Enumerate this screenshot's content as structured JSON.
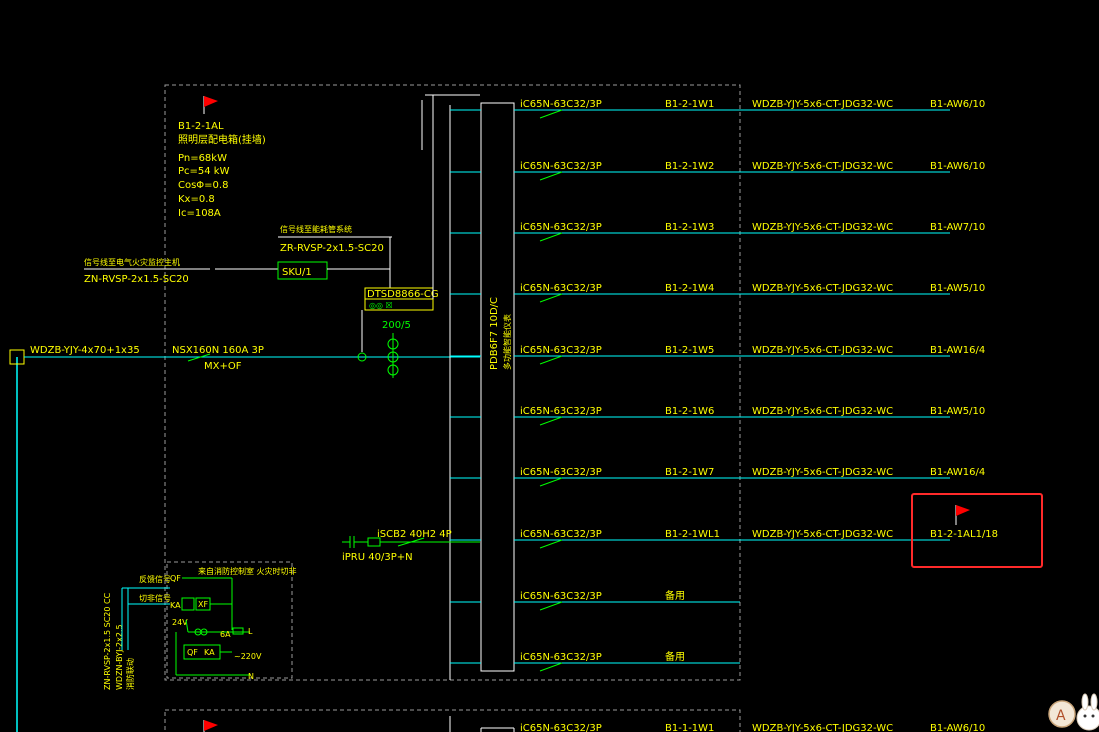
{
  "panel": {
    "id": "B1-2-1AL",
    "name": "照明层配电箱(挂墙)",
    "params": [
      "Pn=68kW",
      "Pc=54 kW",
      "CosΦ=0.8",
      "Kx=0.8",
      "Ic=108A"
    ]
  },
  "incoming": {
    "cable": "WDZB-YJY-4x70+1x35",
    "breaker": "NSX160N 160A 3P",
    "breaker_sub": "MX+OF"
  },
  "fire_monitor": {
    "title": "信号线至电气火灾监控主机",
    "cable": "ZN-RVSP-2x1.5-SC20"
  },
  "energy_monitor": {
    "title": "信号线至能耗管系统",
    "cable": "ZR-RVSP-2x1.5-SC20",
    "module": "SKU/1",
    "meter": "DTSD8866-CG",
    "meter_sub": "◎◎ ☒",
    "ct": "200/5"
  },
  "busbar": {
    "label": "PDB6F7 10D/C",
    "sub": "多功能智能仪表"
  },
  "spd": {
    "breaker": "iSCB2 40H2 4P",
    "surge": "iPRU 40/3P+N"
  },
  "circuits": [
    {
      "breaker": "iC65N-63C32/3P",
      "id": "B1-2-1W1",
      "cable": "WDZB-YJY-5x6-CT-JDG32-WC",
      "dest": "B1-AW6/10"
    },
    {
      "breaker": "iC65N-63C32/3P",
      "id": "B1-2-1W2",
      "cable": "WDZB-YJY-5x6-CT-JDG32-WC",
      "dest": "B1-AW6/10"
    },
    {
      "breaker": "iC65N-63C32/3P",
      "id": "B1-2-1W3",
      "cable": "WDZB-YJY-5x6-CT-JDG32-WC",
      "dest": "B1-AW7/10"
    },
    {
      "breaker": "iC65N-63C32/3P",
      "id": "B1-2-1W4",
      "cable": "WDZB-YJY-5x6-CT-JDG32-WC",
      "dest": "B1-AW5/10"
    },
    {
      "breaker": "iC65N-63C32/3P",
      "id": "B1-2-1W5",
      "cable": "WDZB-YJY-5x6-CT-JDG32-WC",
      "dest": "B1-AW16/4"
    },
    {
      "breaker": "iC65N-63C32/3P",
      "id": "B1-2-1W6",
      "cable": "WDZB-YJY-5x6-CT-JDG32-WC",
      "dest": "B1-AW5/10"
    },
    {
      "breaker": "iC65N-63C32/3P",
      "id": "B1-2-1W7",
      "cable": "WDZB-YJY-5x6-CT-JDG32-WC",
      "dest": "B1-AW16/4"
    },
    {
      "breaker": "iC65N-63C32/3P",
      "id": "B1-2-1WL1",
      "cable": "WDZB-YJY-5x6-CT-JDG32-WC",
      "dest": "B1-2-1AL1/18"
    },
    {
      "breaker": "iC65N-63C32/3P",
      "id": "备用",
      "cable": "",
      "dest": ""
    },
    {
      "breaker": "iC65N-63C32/3P",
      "id": "备用",
      "cable": "",
      "dest": ""
    }
  ],
  "control": {
    "cable_a": "ZN-RVSP-2x1.5 SC20 CC",
    "cable_b": "WDZN-BYJ-2x2.5",
    "title": "消防联动",
    "labels": [
      "反馈信号",
      "切非信号",
      "KA",
      "24V",
      "XF",
      "QF",
      "KA",
      "6A",
      "~220V",
      "N",
      "L"
    ],
    "note": "来自消防控制室 火灾时切非"
  },
  "next_panel": {
    "breaker": "iC65N-63C32/3P",
    "id": "B1-1-1W1",
    "cable": "WDZB-YJY-5x6-CT-JDG32-WC",
    "dest": "B1-AW6/10"
  },
  "avatar": {
    "letter": "A"
  },
  "colors": {
    "line": "#00ffff",
    "text": "#ffff00",
    "green": "#00ff00",
    "highlight": "#ff2a2a",
    "frame": "#9a9a9a"
  }
}
